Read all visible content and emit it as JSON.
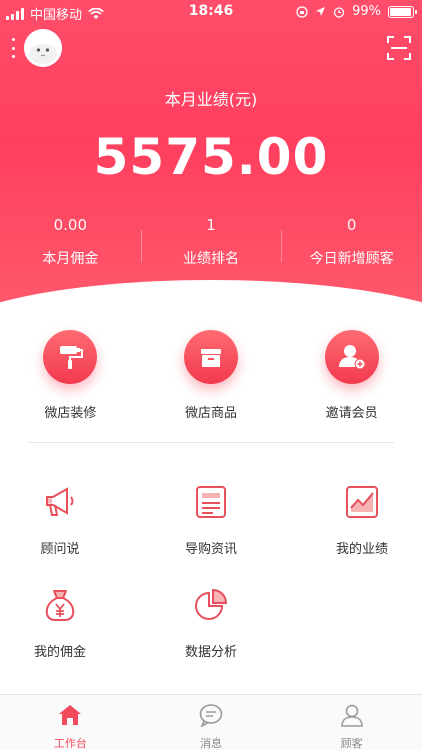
{
  "status_bar": {
    "carrier": "中国移动",
    "time": "18:46",
    "battery": "99%"
  },
  "header": {
    "metric_title": "本月业绩(元)",
    "metric_value": "5575.00",
    "stats": [
      {
        "value": "0.00",
        "label": "本月佣金"
      },
      {
        "value": "1",
        "label": "业绩排名"
      },
      {
        "value": "0",
        "label": "今日新增顾客"
      }
    ]
  },
  "quick_actions": [
    {
      "label": "微店装修",
      "icon": "paint-roller-icon"
    },
    {
      "label": "微店商品",
      "icon": "box-icon"
    },
    {
      "label": "邀请会员",
      "icon": "add-user-icon"
    }
  ],
  "tools": [
    {
      "label": "顾问说",
      "icon": "megaphone-icon"
    },
    {
      "label": "导购资讯",
      "icon": "news-icon"
    },
    {
      "label": "我的业绩",
      "icon": "performance-chart-icon"
    },
    {
      "label": "我的佣金",
      "icon": "money-bag-icon"
    },
    {
      "label": "数据分析",
      "icon": "pie-chart-icon"
    }
  ],
  "tabbar": [
    {
      "label": "工作台",
      "icon": "home-icon",
      "active": true
    },
    {
      "label": "消息",
      "icon": "message-icon",
      "active": false
    },
    {
      "label": "顾客",
      "icon": "customer-icon",
      "active": false
    }
  ],
  "colors": {
    "brand": "#ff4561",
    "accent": "#f24b5b"
  }
}
